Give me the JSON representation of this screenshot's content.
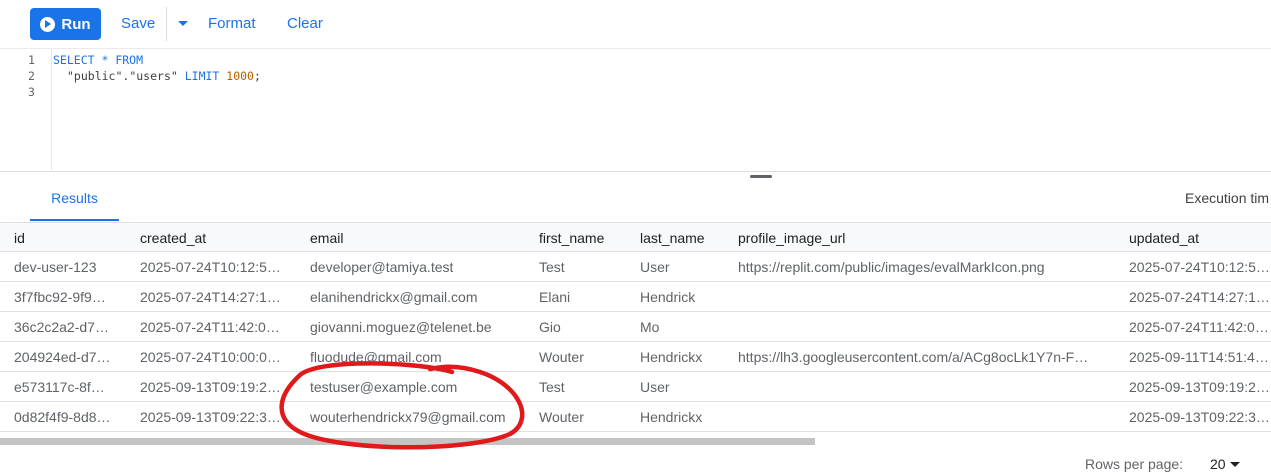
{
  "toolbar": {
    "run": "Run",
    "save": "Save",
    "format": "Format",
    "clear": "Clear"
  },
  "editor": {
    "line_numbers": [
      "1",
      "2",
      "3"
    ],
    "line1": {
      "select": "SELECT",
      "star": " * ",
      "from": "FROM"
    },
    "line2": {
      "schema": "\"public\"",
      "dot": ".",
      "table": "\"users\"",
      "limit": " LIMIT ",
      "count": "1000",
      "semi": ";"
    }
  },
  "tabs": {
    "results": "Results",
    "execution": "Execution tim"
  },
  "columns": [
    "id",
    "created_at",
    "email",
    "first_name",
    "last_name",
    "profile_image_url",
    "updated_at"
  ],
  "rows": [
    [
      "dev-user-123",
      "2025-07-24T10:12:5…",
      "developer@tamiya.test",
      "Test",
      "User",
      "https://replit.com/public/images/evalMarkIcon.png",
      "2025-07-24T10:12:5…"
    ],
    [
      "3f7fbc92-9f9…",
      "2025-07-24T14:27:1…",
      "elanihendrickx@gmail.com",
      "Elani",
      "Hendrick",
      "",
      "2025-07-24T14:27:1…"
    ],
    [
      "36c2c2a2-d7…",
      "2025-07-24T11:42:0…",
      "giovanni.moguez@telenet.be",
      "Gio",
      "Mo",
      "",
      "2025-07-24T11:42:0…"
    ],
    [
      "204924ed-d7…",
      "2025-07-24T10:00:0…",
      "fluodude@gmail.com",
      "Wouter",
      "Hendrickx",
      "https://lh3.googleusercontent.com/a/ACg8ocLk1Y7n-F…",
      "2025-09-11T14:51:4…"
    ],
    [
      "e573117c-8f…",
      "2025-09-13T09:19:2…",
      "testuser@example.com",
      "Test",
      "User",
      "",
      "2025-09-13T09:19:2…"
    ],
    [
      "0d82f4f9-8d8…",
      "2025-09-13T09:22:3…",
      "wouterhendrickx79@gmail.com",
      "Wouter",
      "Hendrickx",
      "",
      "2025-09-13T09:22:3…"
    ]
  ],
  "footer": {
    "rows_per_page_label": "Rows per page:",
    "rows_per_page_value": "20"
  },
  "colors": {
    "accent": "#1a73e8",
    "annotation": "#e0191a"
  }
}
